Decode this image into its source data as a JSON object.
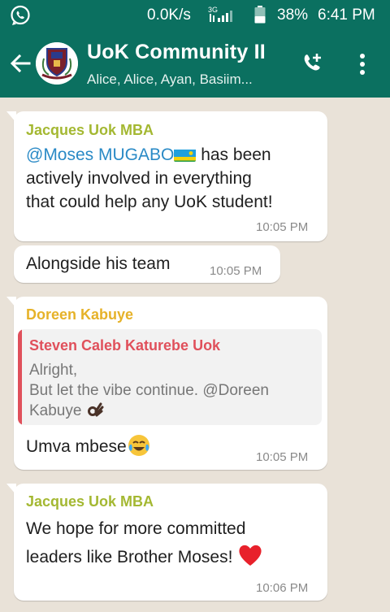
{
  "status_bar": {
    "network_speed": "0.0K/s",
    "network_type": "3G",
    "battery": "38%",
    "time": "6:41 PM"
  },
  "header": {
    "title": "UoK Community II",
    "subtitle": "Alice, Alice, Ayan, Basiim..."
  },
  "messages": [
    {
      "sender": "Jacques Uok MBA",
      "sender_color": "#a4b832",
      "mention": "@Moses MUGABO",
      "text_line1_rest": " has been",
      "text_line2": "actively involved in everything",
      "text_line3": "that could help any UoK student!",
      "time": "10:05 PM"
    },
    {
      "text": "Alongside his team",
      "time": "10:05 PM"
    },
    {
      "sender": "Doreen Kabuye",
      "sender_color": "#e6b229",
      "quote_sender": "Steven Caleb Katurebe Uok",
      "quote_sender_color": "#e0505b",
      "quote_line1": "Alright,",
      "quote_line2": "But let the vibe continue. @Doreen",
      "quote_line3": "Kabuye",
      "text": "Umva mbese",
      "time": "10:05 PM"
    },
    {
      "sender": "Jacques Uok MBA",
      "sender_color": "#a4b832",
      "text_line1": "We hope for more committed",
      "text_line2": "leaders like Brother Moses!",
      "time": "10:06 PM"
    }
  ],
  "icons": {
    "app": "whatsapp-icon",
    "back": "arrow-left-icon",
    "call": "add-call-icon",
    "menu": "more-vert-icon",
    "flag": "rwanda-flag-emoji",
    "hand": "ok-hand-emoji",
    "laugh": "tears-of-joy-emoji",
    "heart": "red-heart-emoji"
  },
  "colors": {
    "header_bg": "#0b7060",
    "chat_bg": "#e9e2d8",
    "mention": "#2a8ac6"
  }
}
